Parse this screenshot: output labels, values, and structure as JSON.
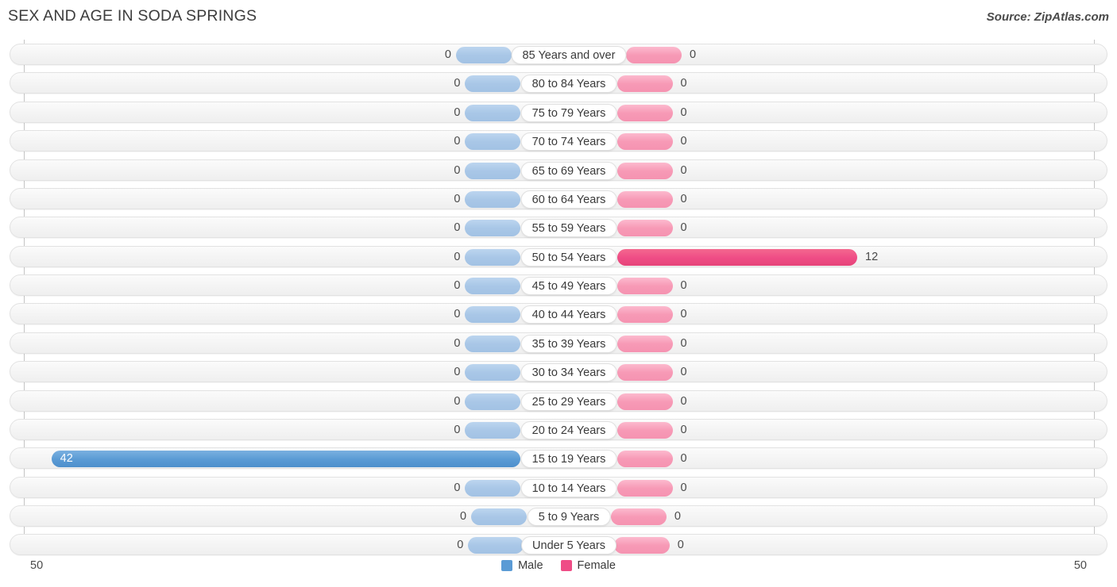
{
  "header": {
    "title": "SEX AND AGE IN SODA SPRINGS",
    "source": "Source: ZipAtlas.com"
  },
  "legend": {
    "male_label": "Male",
    "female_label": "Female",
    "male_color": "#5b9bd5",
    "female_color": "#ef4d86"
  },
  "axis": {
    "left_tick": "50",
    "right_tick": "50",
    "max": 50
  },
  "chart_data": {
    "type": "bar",
    "title": "SEX AND AGE IN SODA SPRINGS",
    "subtitle": "Source: ZipAtlas.com",
    "orientation": "horizontal",
    "style": "population-pyramid",
    "xlabel": "",
    "ylabel": "",
    "xlim": [
      50,
      50
    ],
    "grid": false,
    "legend_position": "bottom-center",
    "categories": [
      "85 Years and over",
      "80 to 84 Years",
      "75 to 79 Years",
      "70 to 74 Years",
      "65 to 69 Years",
      "60 to 64 Years",
      "55 to 59 Years",
      "50 to 54 Years",
      "45 to 49 Years",
      "40 to 44 Years",
      "35 to 39 Years",
      "30 to 34 Years",
      "25 to 29 Years",
      "20 to 24 Years",
      "15 to 19 Years",
      "10 to 14 Years",
      "5 to 9 Years",
      "Under 5 Years"
    ],
    "series": [
      {
        "name": "Male",
        "color": "#5b9bd5",
        "values": [
          0,
          0,
          0,
          0,
          0,
          0,
          0,
          0,
          0,
          0,
          0,
          0,
          0,
          0,
          42,
          0,
          0,
          0
        ]
      },
      {
        "name": "Female",
        "color": "#ef4d86",
        "values": [
          0,
          0,
          0,
          0,
          0,
          0,
          0,
          12,
          0,
          0,
          0,
          0,
          0,
          0,
          0,
          0,
          0,
          0
        ]
      }
    ]
  },
  "rows": [
    {
      "label": "85 Years and over",
      "male": "0",
      "female": "0"
    },
    {
      "label": "80 to 84 Years",
      "male": "0",
      "female": "0"
    },
    {
      "label": "75 to 79 Years",
      "male": "0",
      "female": "0"
    },
    {
      "label": "70 to 74 Years",
      "male": "0",
      "female": "0"
    },
    {
      "label": "65 to 69 Years",
      "male": "0",
      "female": "0"
    },
    {
      "label": "60 to 64 Years",
      "male": "0",
      "female": "0"
    },
    {
      "label": "55 to 59 Years",
      "male": "0",
      "female": "0"
    },
    {
      "label": "50 to 54 Years",
      "male": "0",
      "female": "12"
    },
    {
      "label": "45 to 49 Years",
      "male": "0",
      "female": "0"
    },
    {
      "label": "40 to 44 Years",
      "male": "0",
      "female": "0"
    },
    {
      "label": "35 to 39 Years",
      "male": "0",
      "female": "0"
    },
    {
      "label": "30 to 34 Years",
      "male": "0",
      "female": "0"
    },
    {
      "label": "25 to 29 Years",
      "male": "0",
      "female": "0"
    },
    {
      "label": "20 to 24 Years",
      "male": "0",
      "female": "0"
    },
    {
      "label": "15 to 19 Years",
      "male": "42",
      "female": "0"
    },
    {
      "label": "10 to 14 Years",
      "male": "0",
      "female": "0"
    },
    {
      "label": "5 to 9 Years",
      "male": "0",
      "female": "0"
    },
    {
      "label": "Under 5 Years",
      "male": "0",
      "female": "0"
    }
  ]
}
